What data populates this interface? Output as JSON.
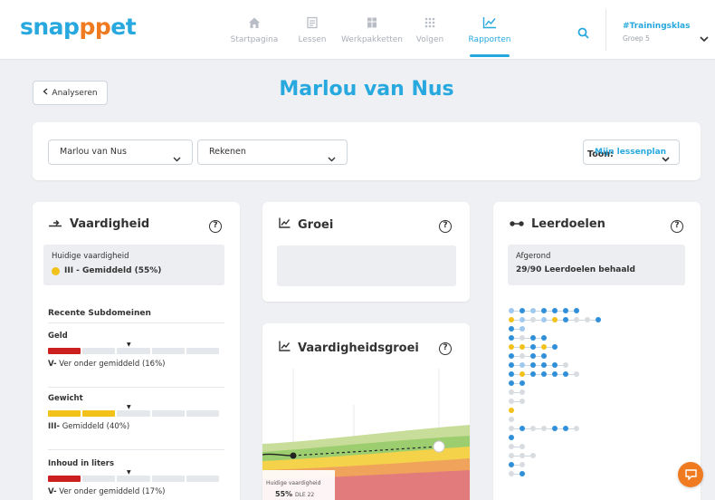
{
  "app": {
    "logo_text_a": "snap",
    "logo_text_p": "p",
    "logo_text_b": "et"
  },
  "nav": {
    "items": [
      {
        "label": "Startpagina",
        "icon": "home-icon",
        "active": false
      },
      {
        "label": "Lessen",
        "icon": "lessons-icon",
        "active": false
      },
      {
        "label": "Werkpakketten",
        "icon": "package-icon",
        "active": false
      },
      {
        "label": "Volgen",
        "icon": "grid-icon",
        "active": false
      },
      {
        "label": "Rapporten",
        "icon": "chart-icon",
        "active": true
      }
    ],
    "class_name": "#Trainingsklas",
    "group": "Groep 5"
  },
  "header": {
    "back_label": "Analyseren",
    "title": "Marlou van Nus"
  },
  "filters": {
    "student": "Marlou van Nus",
    "subject": "Rekenen",
    "show_label": "Toon:",
    "show_value": "Mijn lessenplan"
  },
  "vaardigheid": {
    "title": "Vaardigheid",
    "current_label": "Huidige vaardigheid",
    "current_value": "III - Gemiddeld (55%)",
    "current_color": "#f2c21b",
    "subdomains_title": "Recente Subdomeinen",
    "subdomains": [
      {
        "name": "Geld",
        "level": "V-",
        "desc": " Ver onder gemiddeld (16%)",
        "percent": 16,
        "color": "#cc1f1f"
      },
      {
        "name": "Gewicht",
        "level": "III-",
        "desc": " Gemiddeld (40%)",
        "percent": 40,
        "color": "#f2c21b"
      },
      {
        "name": "Inhoud in liters",
        "level": "V-",
        "desc": " Ver onder gemiddeld (17%)",
        "percent": 17,
        "color": "#cc1f1f"
      }
    ]
  },
  "groei": {
    "title": "Groei"
  },
  "vaardigheidsgroei": {
    "title": "Vaardigheidsgroei",
    "tooltip_label": "Huidige vaardigheid",
    "tooltip_value": "55%",
    "tooltip_suffix": "DLE 22"
  },
  "leerdoelen": {
    "title": "Leerdoelen",
    "done_label": "Afgerond",
    "done_value": "29/90 Leerdoelen behaald",
    "colors": {
      "done": "#2f8fd8",
      "light": "#9fc9ee",
      "yellow": "#f2c21b",
      "grey": "#d8dce1"
    },
    "rows": [
      [
        "light",
        "done",
        "light",
        "done",
        "done",
        "done",
        "done"
      ],
      [
        "yellow",
        "light",
        "grey",
        "light",
        "yellow",
        "done",
        "grey",
        "grey",
        "done"
      ],
      [
        "done",
        "light"
      ],
      [
        "done",
        "grey",
        "done",
        "done"
      ],
      [
        "yellow",
        "yellow",
        "done",
        "yellow",
        "done"
      ],
      [
        "done",
        "grey",
        "done",
        "done"
      ],
      [
        "done",
        "light",
        "done",
        "done",
        "done",
        "grey"
      ],
      [
        "done",
        "yellow",
        "done",
        "done",
        "done",
        "done",
        "grey"
      ],
      [
        "done",
        "done"
      ],
      [
        "grey",
        "grey"
      ],
      [
        "grey",
        "grey"
      ],
      [
        "yellow"
      ],
      [
        "grey"
      ],
      [
        "grey",
        "done",
        "grey",
        "grey",
        "done",
        "done",
        "grey"
      ],
      [
        "done"
      ],
      [
        "grey",
        "grey"
      ],
      [
        "grey",
        "grey",
        "grey"
      ],
      [
        "done",
        "grey"
      ],
      [
        "grey",
        "done"
      ]
    ]
  }
}
